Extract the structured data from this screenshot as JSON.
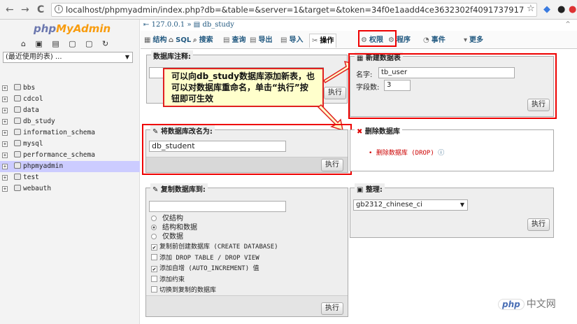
{
  "browser": {
    "back": "←",
    "forward": "→",
    "reload": "C",
    "info": "i",
    "url": "localhost/phpmyadmin/index.php?db=&table=&server=1&target=&token=34f0e1aadd4ce3632302f4091737917",
    "star": "☆"
  },
  "sidebar": {
    "logo_php": "php",
    "logo_my": "MyAdmin",
    "quick_icons": "⌂ ▣ ▤ ▢ ▢ ↻",
    "recent": "(最近使用的表) ...",
    "databases": [
      "bbs",
      "cdcol",
      "data",
      "db_study",
      "information_schema",
      "mysql",
      "performance_schema",
      "phpmyadmin",
      "test",
      "webauth"
    ],
    "selected": "phpmyadmin"
  },
  "breadcrumb": {
    "server": "127.0.0.1",
    "sep": "»",
    "db": "db_study"
  },
  "tabs": [
    {
      "label": "结构",
      "icon": "▦"
    },
    {
      "label": "SQL",
      "icon": "⌂"
    },
    {
      "label": "搜索",
      "icon": "⌕"
    },
    {
      "label": "查询",
      "icon": "▤"
    },
    {
      "label": "导出",
      "icon": "▤"
    },
    {
      "label": "导入",
      "icon": "▤"
    },
    {
      "label": "操作",
      "icon": "✂"
    },
    {
      "label": "权限",
      "icon": "⚙"
    },
    {
      "label": "程序",
      "icon": "⚙"
    },
    {
      "label": "事件",
      "icon": "◔"
    },
    {
      "label": "更多",
      "icon": "▾"
    }
  ],
  "comment": {
    "legend": "数据库注释:",
    "value": "",
    "button": "执行"
  },
  "create_table": {
    "legend": "新建数据表",
    "name_label": "名字:",
    "name_value": "tb_user",
    "fields_label": "字段数:",
    "fields_value": "3",
    "button": "执行"
  },
  "rename": {
    "legend": "将数据库改名为:",
    "value": "db_student",
    "button": "执行"
  },
  "drop": {
    "legend": "删除数据库",
    "link": "删除数据库 (DROP)"
  },
  "copy": {
    "legend": "复制数据库到:",
    "value": "",
    "radios": [
      "仅结构",
      "结构和数据",
      "仅数据"
    ],
    "checks": [
      {
        "label": "复制前创建数据库 (CREATE DATABASE)",
        "checked": true
      },
      {
        "label": "添加 DROP TABLE / DROP VIEW",
        "checked": false
      },
      {
        "label": "添加自增 (AUTO_INCREMENT) 值",
        "checked": true
      },
      {
        "label": "添加约束",
        "checked": false
      },
      {
        "label": "切换到复制的数据库",
        "checked": false
      }
    ],
    "button": "执行"
  },
  "collation": {
    "legend": "整理:",
    "value": "gb2312_chinese_ci",
    "button": "执行"
  },
  "callout": {
    "text": "可以向db_study数据库添加新表，也可以对数据库重命名，单击“执行”按钮即可生效"
  },
  "watermark": {
    "logo": "php",
    "text": "中文网"
  },
  "colors": {
    "highlight": "#e00000",
    "link": "#235a81",
    "panel": "#eeeeee"
  }
}
